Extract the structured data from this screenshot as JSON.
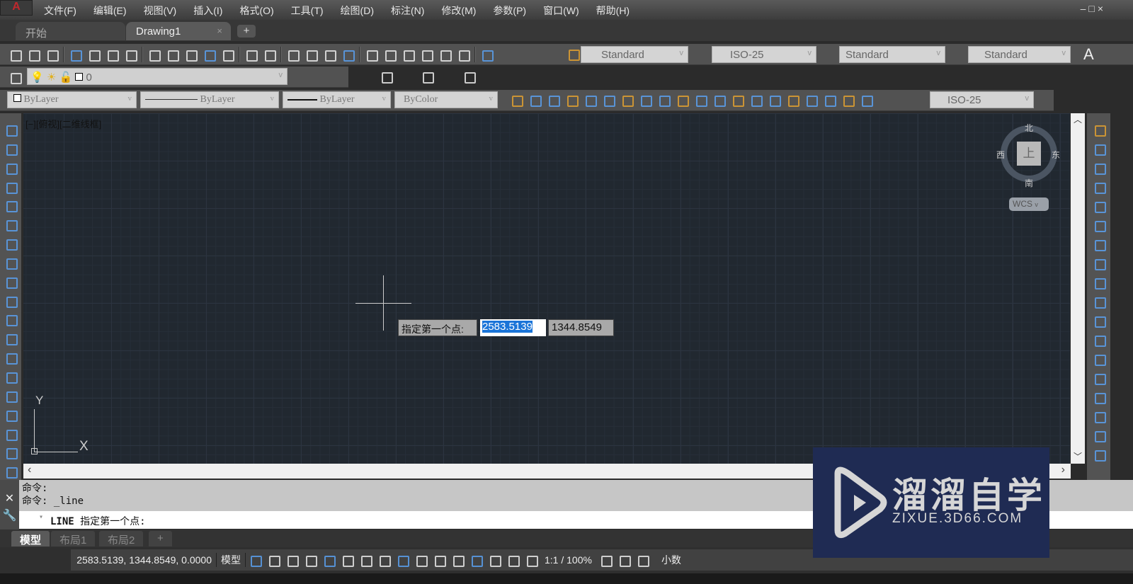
{
  "app_logo": "A",
  "menu": [
    "文件(F)",
    "编辑(E)",
    "视图(V)",
    "插入(I)",
    "格式(O)",
    "工具(T)",
    "绘图(D)",
    "标注(N)",
    "修改(M)",
    "参数(P)",
    "窗口(W)",
    "帮助(H)"
  ],
  "window_controls": "–□×",
  "tabs": {
    "start": "开始",
    "drawing": "Drawing1",
    "close": "×",
    "add": "+"
  },
  "toolbar1_icons": [
    "new-icon",
    "open-icon",
    "save-icon",
    "print-icon",
    "print-preview-icon",
    "publish-icon",
    "render-icon",
    "cut-icon",
    "copy-icon",
    "paste-icon",
    "match-properties-icon",
    "block-editor-icon",
    "undo-icon",
    "redo-icon",
    "pan-icon",
    "zoom-realtime-icon",
    "zoom-window-icon",
    "zoom-previous-icon",
    "properties-icon",
    "design-center-icon",
    "tool-palettes-icon",
    "sheet-set-icon",
    "markup-icon",
    "calculator-icon",
    "help-icon"
  ],
  "styles": {
    "text_style": "Standard",
    "dim_style": "ISO-25",
    "table_style": "Standard",
    "mleader_style": "Standard"
  },
  "layer": {
    "current": "0"
  },
  "properties": {
    "color": "ByLayer",
    "linetype": "ByLayer",
    "lineweight": "ByLayer",
    "plotstyle": "ByColor"
  },
  "dim_icons": [
    "linear-dim-icon",
    "aligned-dim-icon",
    "arc-length-icon",
    "ordinate-dim-icon",
    "radius-dim-icon",
    "jogged-dim-icon",
    "diameter-dim-icon",
    "angular-dim-icon",
    "quick-dim-icon",
    "baseline-dim-icon",
    "continue-dim-icon",
    "dim-space-icon",
    "dim-break-icon",
    "tolerance-icon",
    "center-mark-icon",
    "inspection-icon",
    "jogged-linear-icon",
    "dim-edit-icon",
    "dim-text-edit-icon",
    "dim-update-icon"
  ],
  "dim_style2": "ISO-25",
  "left_palette": [
    "line-icon",
    "construction-line-icon",
    "polyline-icon",
    "polygon-icon",
    "rectangle-icon",
    "arc-icon",
    "circle-icon",
    "revision-cloud-icon",
    "spline-icon",
    "ellipse-icon",
    "ellipse-arc-icon",
    "insert-block-icon",
    "make-block-icon",
    "point-icon",
    "hatch-icon",
    "gradient-icon",
    "region-icon",
    "table-icon",
    "mtext-icon"
  ],
  "right_palette": [
    "erase-icon",
    "copy-object-icon",
    "mirror-icon",
    "offset-icon",
    "array-icon",
    "move-icon",
    "rotate-icon",
    "scale-icon",
    "stretch-icon",
    "trim-icon",
    "extend-icon",
    "break-at-point-icon",
    "break-icon",
    "join-icon",
    "chamfer-icon",
    "fillet-icon",
    "blend-icon",
    "explode-icon"
  ],
  "viewport_label": "[−][俯视][二维线框]",
  "viewcube": {
    "north": "北",
    "south": "南",
    "east": "东",
    "west": "西",
    "top": "上",
    "ucs": "WCS"
  },
  "dynamic_input": {
    "prompt": "指定第一个点:",
    "x": "2583.5139",
    "y": "1344.8549"
  },
  "ucs_icon": {
    "x": "X",
    "y": "Y"
  },
  "command": {
    "history": [
      "命令:",
      "命令: _line"
    ],
    "current_cmd": "LINE",
    "current_prompt": "指定第一个点:"
  },
  "layout_tabs": [
    "模型",
    "布局1",
    "布局2",
    "+"
  ],
  "status": {
    "coords": "2583.5139, 1344.8549, 0.0000",
    "space": "模型",
    "scale": "1:1 / 100%",
    "units": "小数"
  },
  "watermark": {
    "title": "溜溜自学",
    "url": "ZIXUE.3D66.COM"
  }
}
